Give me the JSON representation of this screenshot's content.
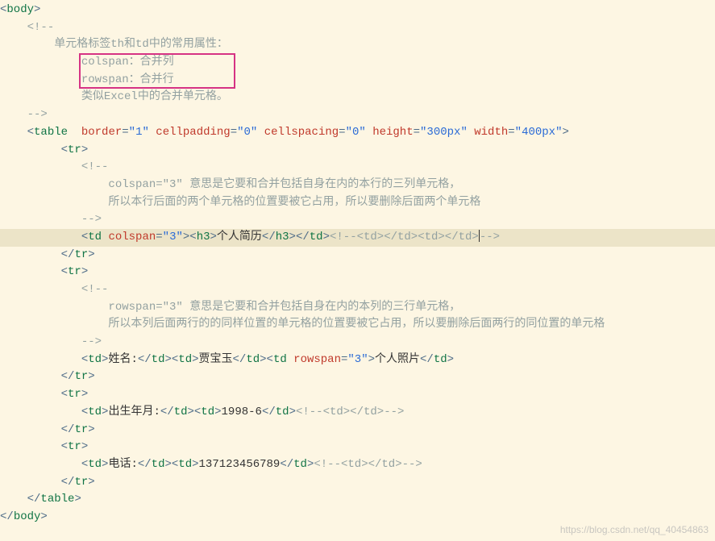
{
  "indent": {
    "s0": "",
    "s1": "    ",
    "s2": "        ",
    "s21": "         ",
    "s3": "            ",
    "s4": "                "
  },
  "code": {
    "body_open": "body",
    "body_close": "body",
    "table_open": "table",
    "table_close": "table",
    "tr": "tr",
    "td": "td",
    "h3": "h3",
    "cmt_open": "<!--",
    "cmt_close": "-->",
    "cmt_dash_open": "<!--",
    "cmt_dash_close": "-->"
  },
  "attrs": {
    "border_n": "border",
    "border_v": "\"1\"",
    "cellpadding_n": "cellpadding",
    "cellpadding_v": "\"0\"",
    "cellspacing_n": "cellspacing",
    "cellspacing_v": "\"0\"",
    "height_n": "height",
    "height_v": "\"300px\"",
    "width_n": "width",
    "width_v": "\"400px\"",
    "colspan_n": "colspan",
    "colspan_v": "\"3\"",
    "rowspan_n": "rowspan",
    "rowspan_v": "\"3\""
  },
  "comment1": {
    "l1": "单元格标签th和td中的常用属性：",
    "l2": "colspan：合并列",
    "l3": "rowspan：合并行",
    "l4": "类似Excel中的合并单元格。"
  },
  "comment2": {
    "l1": "colspan=\"3\" 意思是它要和合并包括自身在内的本行的三列单元格，",
    "l2": "所以本行后面的两个单元格的位置要被它占用，所以要删除后面两个单元格"
  },
  "comment3": {
    "l1": "rowspan=\"3\" 意思是它要和合并包括自身在内的本列的三行单元格，",
    "l2": "所以本列后面两行的的同样位置的单元格的位置要被它占用，所以要删除后面两行的同位置的单元格"
  },
  "texts": {
    "resume": "个人简历",
    "name_label": "姓名:",
    "name_val": "贾宝玉",
    "photo": "个人照片",
    "dob_label": "出生年月:",
    "dob_val": "1998-6",
    "tel_label": "电话:",
    "tel_val": "137123456789",
    "td_td": "<td></td><td></td>",
    "td_only": "<td></td>"
  },
  "watermark": "https://blog.csdn.net/qq_40454863"
}
